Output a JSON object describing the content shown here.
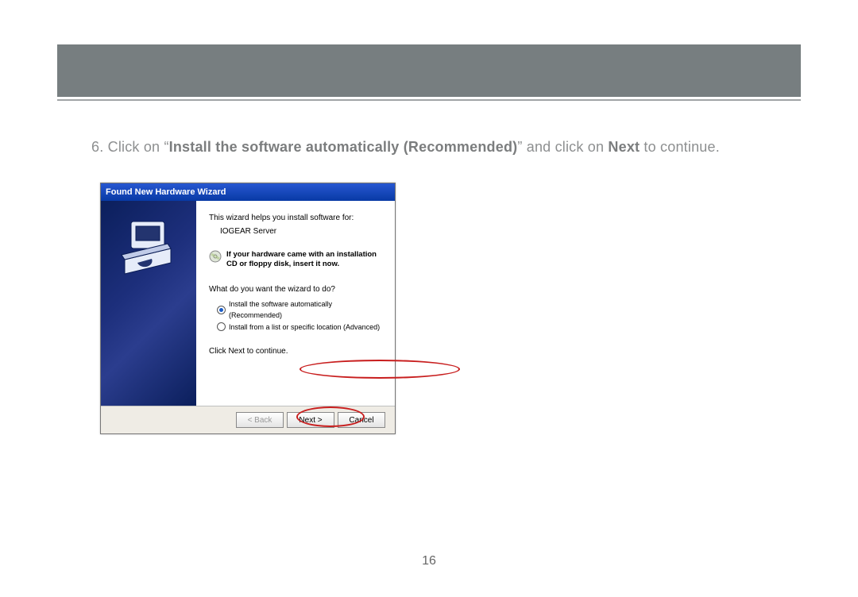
{
  "instruction": {
    "number": "6.",
    "pre": "Click on “",
    "bold1": "Install the software automatically (Recommended)",
    "mid": "” and click on ",
    "bold2": "Next",
    "post": " to continue."
  },
  "wizard": {
    "title": "Found New Hardware Wizard",
    "intro": "This wizard helps you install software for:",
    "device": "IOGEAR Server",
    "cd_hint": "If your hardware came with an installation CD or floppy disk, insert it now.",
    "prompt": "What do you want the wizard to do?",
    "option_auto": "Install the software automatically (Recommended)",
    "option_list": "Install from a list or specific location (Advanced)",
    "continue": "Click Next to continue.",
    "buttons": {
      "back": "< Back",
      "next": "Next >",
      "cancel": "Cancel"
    }
  },
  "page_number": "16"
}
